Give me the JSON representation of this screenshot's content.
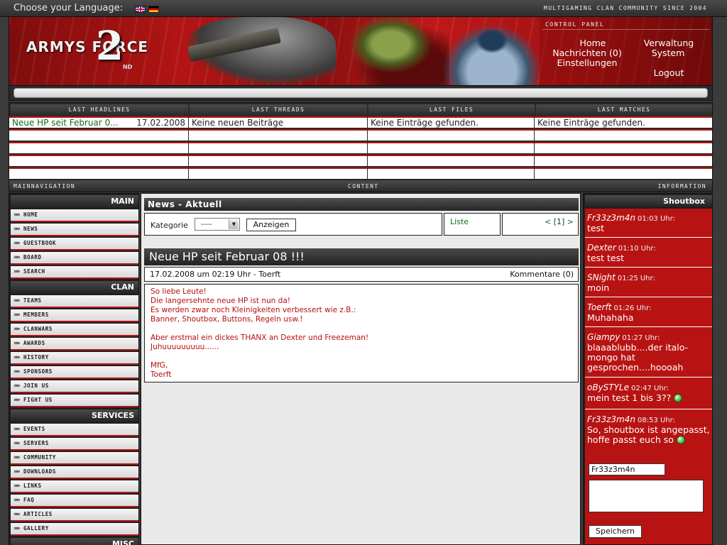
{
  "header": {
    "language_label": "Choose your Language:",
    "languages": [
      "English",
      "Deutsch"
    ],
    "tagline": "Multigaming Clan Community since 2004",
    "logo_text": "ARMYS  FORCE",
    "logo_number": "2",
    "logo_suffix": "ND",
    "control_panel": {
      "title": "Control Panel",
      "links": {
        "home": "Home",
        "verwaltung": "Verwaltung",
        "nachrichten": "Nachrichten (0)",
        "system": "System",
        "einstellungen": "Einstellungen",
        "logout": "Logout"
      }
    }
  },
  "info": {
    "headers": [
      "Last Headlines",
      "Last Threads",
      "Last Files",
      "Last Matches"
    ],
    "headline": {
      "title": "Neue HP seit Februar 0...",
      "date": "17.02.2008"
    },
    "threads_empty": "Keine neuen Beiträge",
    "files_empty": "Keine Einträge gefunden.",
    "matches_empty": "Keine Einträge gefunden."
  },
  "sections": {
    "left": "Mainnavigation",
    "center": "Content",
    "right": "Information"
  },
  "nav": {
    "main_title": "Main",
    "main": [
      "Home",
      "News",
      "Guestbook",
      "Board",
      "Search"
    ],
    "clan_title": "Clan",
    "clan": [
      "Teams",
      "Members",
      "Clanwars",
      "Awards",
      "History",
      "Sponsors",
      "Join us",
      "Fight us"
    ],
    "services_title": "Services",
    "services": [
      "Events",
      "Servers",
      "Community",
      "Downloads",
      "Links",
      "FAQ",
      "Articles",
      "Gallery"
    ],
    "misc_title": "Misc"
  },
  "content": {
    "title": "News - Aktuell",
    "filter": {
      "label": "Kategorie",
      "selected": "----",
      "button": "Anzeigen"
    },
    "list_label": "Liste",
    "pager": {
      "prev": "<",
      "current": "[1]",
      "next": ">"
    },
    "post": {
      "title": "Neue HP seit Februar 08 !!!",
      "meta": "17.02.2008 um 02:19 Uhr - Toerft",
      "comments": "Kommentare (0)",
      "body": "So liebe Leute!\nDie langersehnte neue HP ist nun da!\nEs werden zwar noch Kleinigkeiten verbessert wie z.B.:\nBanner, Shoutbox, Buttons, Regeln usw.!\n\nAber erstmal ein dickes THANX an Dexter und Freezeman!\nJuhuuuuuuuuu......\n\nMfG,\nToerft"
    }
  },
  "shoutbox": {
    "title": "Shoutbox",
    "entries": [
      {
        "name": "Fr33z3m4n",
        "time": "01:03 Uhr:",
        "msg": "test",
        "smiley": false
      },
      {
        "name": "Dexter",
        "time": "01:10 Uhr:",
        "msg": "test test",
        "smiley": false
      },
      {
        "name": "SNight",
        "time": "01:25 Uhr:",
        "msg": "moin",
        "smiley": false
      },
      {
        "name": "Toerft",
        "time": "01:26 Uhr:",
        "msg": "Muhahaha",
        "smiley": false
      },
      {
        "name": "Giampy",
        "time": "01:27 Uhr:",
        "msg": "blaaablubb....der italo-mongo hat gesprochen....hoooah",
        "smiley": false
      },
      {
        "name": "oBySTYLe",
        "time": "02:47 Uhr:",
        "msg": "mein test 1 bis 3??",
        "smiley": true
      },
      {
        "name": "Fr33z3m4n",
        "time": "08:53 Uhr:",
        "msg": "So, shoutbox ist angepasst, hoffe passt euch so",
        "smiley": true
      }
    ],
    "name_value": "Fr33z3m4n",
    "submit": "Speichern"
  },
  "colors": {
    "accent": "#b81313",
    "link": "#136b17",
    "dark": "#2a2a2a"
  }
}
